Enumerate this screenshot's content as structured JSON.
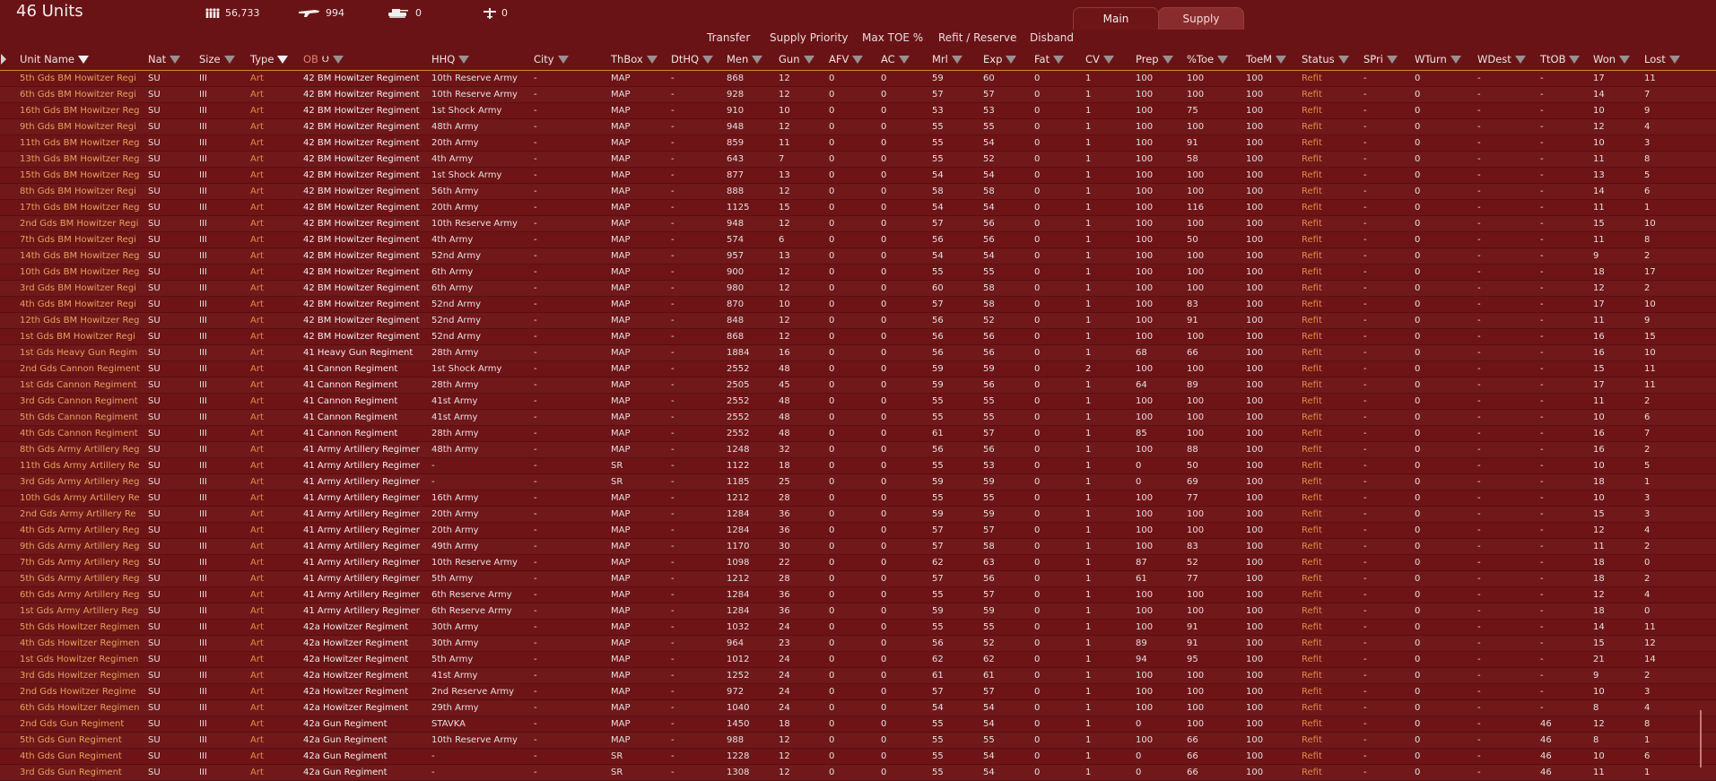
{
  "app": {
    "unit_count": "46 Units",
    "stats": {
      "men": "56,733",
      "guns": "994",
      "afv": "0",
      "aircraft": "0"
    },
    "tabs": {
      "main": "Main",
      "supply": "Supply"
    },
    "actions": {
      "transfer": "Transfer",
      "supply_priority": "Supply Priority",
      "max_toe": "Max TOE %",
      "refit_reserve": "Refit / Reserve",
      "disband": "Disband"
    }
  },
  "columns": {
    "unit_name": "Unit Name",
    "nat": "Nat",
    "size": "Size",
    "type": "Type",
    "ob": "OB",
    "hhq": "HHQ",
    "city": "City",
    "thbox": "ThBox",
    "dthq": "DtHQ",
    "men": "Men",
    "gun": "Gun",
    "afv": "AFV",
    "ac": "AC",
    "mrl": "Mrl",
    "exp": "Exp",
    "fat": "Fat",
    "cv": "CV",
    "prep": "Prep",
    "toe": "%Toe",
    "toem": "ToeM",
    "status": "Status",
    "spri": "SPri",
    "wturn": "WTurn",
    "wdest": "WDest",
    "ttob": "TtOB",
    "won": "Won",
    "lost": "Lost"
  },
  "rows": [
    [
      "5th Gds BM Howitzer Regi",
      "SU",
      "III",
      "Art",
      "42 BM Howitzer Regiment",
      "10th Reserve Army",
      "-",
      "MAP",
      "-",
      "868",
      "12",
      "0",
      "0",
      "59",
      "60",
      "0",
      "1",
      "100",
      "100",
      "100",
      "Refit",
      "-",
      "0",
      "-",
      "-",
      "17",
      "11"
    ],
    [
      "6th Gds BM Howitzer Regi",
      "SU",
      "III",
      "Art",
      "42 BM Howitzer Regiment",
      "10th Reserve Army",
      "-",
      "MAP",
      "-",
      "928",
      "12",
      "0",
      "0",
      "57",
      "57",
      "0",
      "1",
      "100",
      "100",
      "100",
      "Refit",
      "-",
      "0",
      "-",
      "-",
      "14",
      "7"
    ],
    [
      "16th Gds BM Howitzer Reg",
      "SU",
      "III",
      "Art",
      "42 BM Howitzer Regiment",
      "1st Shock Army",
      "-",
      "MAP",
      "-",
      "910",
      "10",
      "0",
      "0",
      "53",
      "53",
      "0",
      "1",
      "100",
      "75",
      "100",
      "Refit",
      "-",
      "0",
      "-",
      "-",
      "10",
      "9"
    ],
    [
      "9th Gds BM Howitzer Regi",
      "SU",
      "III",
      "Art",
      "42 BM Howitzer Regiment",
      "48th Army",
      "-",
      "MAP",
      "-",
      "948",
      "12",
      "0",
      "0",
      "55",
      "55",
      "0",
      "1",
      "100",
      "100",
      "100",
      "Refit",
      "-",
      "0",
      "-",
      "-",
      "12",
      "4"
    ],
    [
      "11th Gds BM Howitzer Reg",
      "SU",
      "III",
      "Art",
      "42 BM Howitzer Regiment",
      "20th Army",
      "-",
      "MAP",
      "-",
      "859",
      "11",
      "0",
      "0",
      "55",
      "54",
      "0",
      "1",
      "100",
      "91",
      "100",
      "Refit",
      "-",
      "0",
      "-",
      "-",
      "10",
      "3"
    ],
    [
      "13th Gds BM Howitzer Reg",
      "SU",
      "III",
      "Art",
      "42 BM Howitzer Regiment",
      "4th Army",
      "-",
      "MAP",
      "-",
      "643",
      "7",
      "0",
      "0",
      "55",
      "52",
      "0",
      "1",
      "100",
      "58",
      "100",
      "Refit",
      "-",
      "0",
      "-",
      "-",
      "11",
      "8"
    ],
    [
      "15th Gds BM Howitzer Reg",
      "SU",
      "III",
      "Art",
      "42 BM Howitzer Regiment",
      "1st Shock Army",
      "-",
      "MAP",
      "-",
      "877",
      "13",
      "0",
      "0",
      "54",
      "54",
      "0",
      "1",
      "100",
      "100",
      "100",
      "Refit",
      "-",
      "0",
      "-",
      "-",
      "13",
      "5"
    ],
    [
      "8th Gds BM Howitzer Regi",
      "SU",
      "III",
      "Art",
      "42 BM Howitzer Regiment",
      "56th Army",
      "-",
      "MAP",
      "-",
      "888",
      "12",
      "0",
      "0",
      "58",
      "58",
      "0",
      "1",
      "100",
      "100",
      "100",
      "Refit",
      "-",
      "0",
      "-",
      "-",
      "14",
      "6"
    ],
    [
      "17th Gds BM Howitzer Reg",
      "SU",
      "III",
      "Art",
      "42 BM Howitzer Regiment",
      "20th Army",
      "-",
      "MAP",
      "-",
      "1125",
      "15",
      "0",
      "0",
      "54",
      "54",
      "0",
      "1",
      "100",
      "116",
      "100",
      "Refit",
      "-",
      "0",
      "-",
      "-",
      "11",
      "1"
    ],
    [
      "2nd Gds BM Howitzer Regi",
      "SU",
      "III",
      "Art",
      "42 BM Howitzer Regiment",
      "10th Reserve Army",
      "-",
      "MAP",
      "-",
      "948",
      "12",
      "0",
      "0",
      "57",
      "56",
      "0",
      "1",
      "100",
      "100",
      "100",
      "Refit",
      "-",
      "0",
      "-",
      "-",
      "15",
      "10"
    ],
    [
      "7th Gds BM Howitzer Regi",
      "SU",
      "III",
      "Art",
      "42 BM Howitzer Regiment",
      "4th Army",
      "-",
      "MAP",
      "-",
      "574",
      "6",
      "0",
      "0",
      "56",
      "56",
      "0",
      "1",
      "100",
      "50",
      "100",
      "Refit",
      "-",
      "0",
      "-",
      "-",
      "11",
      "8"
    ],
    [
      "14th Gds BM Howitzer Reg",
      "SU",
      "III",
      "Art",
      "42 BM Howitzer Regiment",
      "52nd Army",
      "-",
      "MAP",
      "-",
      "957",
      "13",
      "0",
      "0",
      "54",
      "54",
      "0",
      "1",
      "100",
      "100",
      "100",
      "Refit",
      "-",
      "0",
      "-",
      "-",
      "9",
      "2"
    ],
    [
      "10th Gds BM Howitzer Reg",
      "SU",
      "III",
      "Art",
      "42 BM Howitzer Regiment",
      "6th Army",
      "-",
      "MAP",
      "-",
      "900",
      "12",
      "0",
      "0",
      "55",
      "55",
      "0",
      "1",
      "100",
      "100",
      "100",
      "Refit",
      "-",
      "0",
      "-",
      "-",
      "18",
      "17"
    ],
    [
      "3rd Gds BM Howitzer Regi",
      "SU",
      "III",
      "Art",
      "42 BM Howitzer Regiment",
      "6th Army",
      "-",
      "MAP",
      "-",
      "980",
      "12",
      "0",
      "0",
      "60",
      "58",
      "0",
      "1",
      "100",
      "100",
      "100",
      "Refit",
      "-",
      "0",
      "-",
      "-",
      "12",
      "2"
    ],
    [
      "4th Gds BM Howitzer Regi",
      "SU",
      "III",
      "Art",
      "42 BM Howitzer Regiment",
      "52nd Army",
      "-",
      "MAP",
      "-",
      "870",
      "10",
      "0",
      "0",
      "57",
      "58",
      "0",
      "1",
      "100",
      "83",
      "100",
      "Refit",
      "-",
      "0",
      "-",
      "-",
      "17",
      "10"
    ],
    [
      "12th Gds BM Howitzer Reg",
      "SU",
      "III",
      "Art",
      "42 BM Howitzer Regiment",
      "52nd Army",
      "-",
      "MAP",
      "-",
      "848",
      "12",
      "0",
      "0",
      "56",
      "52",
      "0",
      "1",
      "100",
      "91",
      "100",
      "Refit",
      "-",
      "0",
      "-",
      "-",
      "11",
      "9"
    ],
    [
      "1st Gds BM Howitzer Regi",
      "SU",
      "III",
      "Art",
      "42 BM Howitzer Regiment",
      "52nd Army",
      "-",
      "MAP",
      "-",
      "868",
      "12",
      "0",
      "0",
      "56",
      "56",
      "0",
      "1",
      "100",
      "100",
      "100",
      "Refit",
      "-",
      "0",
      "-",
      "-",
      "16",
      "15"
    ],
    [
      "1st Gds Heavy Gun Regim",
      "SU",
      "III",
      "Art",
      "41 Heavy Gun Regiment",
      "28th Army",
      "-",
      "MAP",
      "-",
      "1884",
      "16",
      "0",
      "0",
      "56",
      "56",
      "0",
      "1",
      "68",
      "66",
      "100",
      "Refit",
      "-",
      "0",
      "-",
      "-",
      "16",
      "10"
    ],
    [
      "2nd Gds Cannon Regiment",
      "SU",
      "III",
      "Art",
      "41 Cannon Regiment",
      "1st Shock Army",
      "-",
      "MAP",
      "-",
      "2552",
      "48",
      "0",
      "0",
      "59",
      "59",
      "0",
      "2",
      "100",
      "100",
      "100",
      "Refit",
      "-",
      "0",
      "-",
      "-",
      "15",
      "11"
    ],
    [
      "1st Gds Cannon Regiment",
      "SU",
      "III",
      "Art",
      "41 Cannon Regiment",
      "28th Army",
      "-",
      "MAP",
      "-",
      "2505",
      "45",
      "0",
      "0",
      "59",
      "56",
      "0",
      "1",
      "64",
      "89",
      "100",
      "Refit",
      "-",
      "0",
      "-",
      "-",
      "17",
      "11"
    ],
    [
      "3rd Gds Cannon Regiment",
      "SU",
      "III",
      "Art",
      "41 Cannon Regiment",
      "41st Army",
      "-",
      "MAP",
      "-",
      "2552",
      "48",
      "0",
      "0",
      "55",
      "55",
      "0",
      "1",
      "100",
      "100",
      "100",
      "Refit",
      "-",
      "0",
      "-",
      "-",
      "11",
      "2"
    ],
    [
      "5th Gds Cannon Regiment",
      "SU",
      "III",
      "Art",
      "41 Cannon Regiment",
      "41st Army",
      "-",
      "MAP",
      "-",
      "2552",
      "48",
      "0",
      "0",
      "55",
      "55",
      "0",
      "1",
      "100",
      "100",
      "100",
      "Refit",
      "-",
      "0",
      "-",
      "-",
      "10",
      "6"
    ],
    [
      "4th Gds Cannon Regiment",
      "SU",
      "III",
      "Art",
      "41 Cannon Regiment",
      "28th Army",
      "-",
      "MAP",
      "-",
      "2552",
      "48",
      "0",
      "0",
      "61",
      "57",
      "0",
      "1",
      "85",
      "100",
      "100",
      "Refit",
      "-",
      "0",
      "-",
      "-",
      "16",
      "7"
    ],
    [
      "8th Gds Army Artillery Reg",
      "SU",
      "III",
      "Art",
      "41 Army Artillery Regiment",
      "48th Army",
      "-",
      "MAP",
      "-",
      "1248",
      "32",
      "0",
      "0",
      "56",
      "56",
      "0",
      "1",
      "100",
      "88",
      "100",
      "Refit",
      "-",
      "0",
      "-",
      "-",
      "16",
      "2"
    ],
    [
      "11th Gds Army Artillery Re",
      "SU",
      "III",
      "Art",
      "41 Army Artillery Regiment",
      "-",
      "-",
      "SR",
      "-",
      "1122",
      "18",
      "0",
      "0",
      "55",
      "53",
      "0",
      "1",
      "0",
      "50",
      "100",
      "Refit",
      "-",
      "0",
      "-",
      "-",
      "10",
      "5"
    ],
    [
      "3rd Gds Army Artillery Reg",
      "SU",
      "III",
      "Art",
      "41 Army Artillery Regiment",
      "-",
      "-",
      "SR",
      "-",
      "1185",
      "25",
      "0",
      "0",
      "59",
      "59",
      "0",
      "1",
      "0",
      "69",
      "100",
      "Refit",
      "-",
      "0",
      "-",
      "-",
      "18",
      "1"
    ],
    [
      "10th Gds Army Artillery Re",
      "SU",
      "III",
      "Art",
      "41 Army Artillery Regiment",
      "16th Army",
      "-",
      "MAP",
      "-",
      "1212",
      "28",
      "0",
      "0",
      "55",
      "55",
      "0",
      "1",
      "100",
      "77",
      "100",
      "Refit",
      "-",
      "0",
      "-",
      "-",
      "10",
      "3"
    ],
    [
      "2nd Gds Army Artillery Re",
      "SU",
      "III",
      "Art",
      "41 Army Artillery Regiment",
      "20th Army",
      "-",
      "MAP",
      "-",
      "1284",
      "36",
      "0",
      "0",
      "59",
      "59",
      "0",
      "1",
      "100",
      "100",
      "100",
      "Refit",
      "-",
      "0",
      "-",
      "-",
      "15",
      "3"
    ],
    [
      "4th Gds Army Artillery Reg",
      "SU",
      "III",
      "Art",
      "41 Army Artillery Regiment",
      "20th Army",
      "-",
      "MAP",
      "-",
      "1284",
      "36",
      "0",
      "0",
      "57",
      "57",
      "0",
      "1",
      "100",
      "100",
      "100",
      "Refit",
      "-",
      "0",
      "-",
      "-",
      "12",
      "4"
    ],
    [
      "9th Gds Army Artillery Reg",
      "SU",
      "III",
      "Art",
      "41 Army Artillery Regiment",
      "49th Army",
      "-",
      "MAP",
      "-",
      "1170",
      "30",
      "0",
      "0",
      "57",
      "58",
      "0",
      "1",
      "100",
      "83",
      "100",
      "Refit",
      "-",
      "0",
      "-",
      "-",
      "11",
      "2"
    ],
    [
      "7th Gds Army Artillery Reg",
      "SU",
      "III",
      "Art",
      "41 Army Artillery Regiment",
      "10th Reserve Army",
      "-",
      "MAP",
      "-",
      "1098",
      "22",
      "0",
      "0",
      "62",
      "63",
      "0",
      "1",
      "87",
      "52",
      "100",
      "Refit",
      "-",
      "0",
      "-",
      "-",
      "18",
      "0"
    ],
    [
      "5th Gds Army Artillery Reg",
      "SU",
      "III",
      "Art",
      "41 Army Artillery Regiment",
      "5th Army",
      "-",
      "MAP",
      "-",
      "1212",
      "28",
      "0",
      "0",
      "57",
      "56",
      "0",
      "1",
      "61",
      "77",
      "100",
      "Refit",
      "-",
      "0",
      "-",
      "-",
      "18",
      "2"
    ],
    [
      "6th Gds Army Artillery Reg",
      "SU",
      "III",
      "Art",
      "41 Army Artillery Regiment",
      "6th Reserve Army",
      "-",
      "MAP",
      "-",
      "1284",
      "36",
      "0",
      "0",
      "55",
      "57",
      "0",
      "1",
      "100",
      "100",
      "100",
      "Refit",
      "-",
      "0",
      "-",
      "-",
      "12",
      "4"
    ],
    [
      "1st Gds Army Artillery Reg",
      "SU",
      "III",
      "Art",
      "41 Army Artillery Regiment",
      "6th Reserve Army",
      "-",
      "MAP",
      "-",
      "1284",
      "36",
      "0",
      "0",
      "59",
      "59",
      "0",
      "1",
      "100",
      "100",
      "100",
      "Refit",
      "-",
      "0",
      "-",
      "-",
      "18",
      "0"
    ],
    [
      "5th Gds Howitzer Regimen",
      "SU",
      "III",
      "Art",
      "42a Howitzer Regiment",
      "30th Army",
      "-",
      "MAP",
      "-",
      "1032",
      "24",
      "0",
      "0",
      "55",
      "55",
      "0",
      "1",
      "100",
      "91",
      "100",
      "Refit",
      "-",
      "0",
      "-",
      "-",
      "14",
      "11"
    ],
    [
      "4th Gds Howitzer Regimen",
      "SU",
      "III",
      "Art",
      "42a Howitzer Regiment",
      "30th Army",
      "-",
      "MAP",
      "-",
      "964",
      "23",
      "0",
      "0",
      "56",
      "52",
      "0",
      "1",
      "89",
      "91",
      "100",
      "Refit",
      "-",
      "0",
      "-",
      "-",
      "15",
      "12"
    ],
    [
      "1st Gds Howitzer Regimen",
      "SU",
      "III",
      "Art",
      "42a Howitzer Regiment",
      "5th Army",
      "-",
      "MAP",
      "-",
      "1012",
      "24",
      "0",
      "0",
      "62",
      "62",
      "0",
      "1",
      "94",
      "95",
      "100",
      "Refit",
      "-",
      "0",
      "-",
      "-",
      "21",
      "14"
    ],
    [
      "3rd Gds Howitzer Regimen",
      "SU",
      "III",
      "Art",
      "42a Howitzer Regiment",
      "41st Army",
      "-",
      "MAP",
      "-",
      "1252",
      "24",
      "0",
      "0",
      "61",
      "61",
      "0",
      "1",
      "100",
      "100",
      "100",
      "Refit",
      "-",
      "0",
      "-",
      "-",
      "9",
      "2"
    ],
    [
      "2nd Gds Howitzer Regime",
      "SU",
      "III",
      "Art",
      "42a Howitzer Regiment",
      "2nd Reserve Army",
      "-",
      "MAP",
      "-",
      "972",
      "24",
      "0",
      "0",
      "57",
      "57",
      "0",
      "1",
      "100",
      "100",
      "100",
      "Refit",
      "-",
      "0",
      "-",
      "-",
      "10",
      "3"
    ],
    [
      "6th Gds Howitzer Regimen",
      "SU",
      "III",
      "Art",
      "42a Howitzer Regiment",
      "29th Army",
      "-",
      "MAP",
      "-",
      "1040",
      "24",
      "0",
      "0",
      "54",
      "54",
      "0",
      "1",
      "100",
      "100",
      "100",
      "Refit",
      "-",
      "0",
      "-",
      "-",
      "8",
      "4"
    ],
    [
      "2nd Gds Gun Regiment",
      "SU",
      "III",
      "Art",
      "42a Gun Regiment",
      "STAVKA",
      "-",
      "MAP",
      "-",
      "1450",
      "18",
      "0",
      "0",
      "55",
      "54",
      "0",
      "1",
      "0",
      "100",
      "100",
      "Refit",
      "-",
      "0",
      "-",
      "46",
      "12",
      "8"
    ],
    [
      "5th Gds Gun Regiment",
      "SU",
      "III",
      "Art",
      "42a Gun Regiment",
      "10th Reserve Army",
      "-",
      "MAP",
      "-",
      "988",
      "12",
      "0",
      "0",
      "55",
      "55",
      "0",
      "1",
      "100",
      "66",
      "100",
      "Refit",
      "-",
      "0",
      "-",
      "46",
      "8",
      "1"
    ],
    [
      "4th Gds Gun Regiment",
      "SU",
      "III",
      "Art",
      "42a Gun Regiment",
      "-",
      "-",
      "SR",
      "-",
      "1228",
      "12",
      "0",
      "0",
      "55",
      "54",
      "0",
      "1",
      "0",
      "66",
      "100",
      "Refit",
      "-",
      "0",
      "-",
      "46",
      "10",
      "6"
    ],
    [
      "3rd Gds Gun Regiment",
      "SU",
      "III",
      "Art",
      "42a Gun Regiment",
      "-",
      "-",
      "SR",
      "-",
      "1308",
      "12",
      "0",
      "0",
      "55",
      "54",
      "0",
      "1",
      "0",
      "66",
      "100",
      "Refit",
      "-",
      "0",
      "-",
      "46",
      "11",
      "1"
    ]
  ]
}
